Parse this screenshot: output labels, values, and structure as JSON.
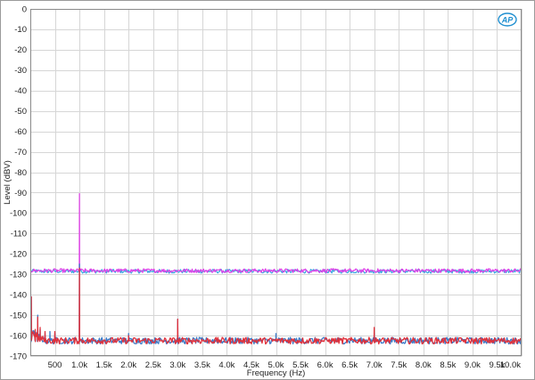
{
  "chart_data": {
    "type": "line",
    "title": "",
    "xlabel": "Frequency (Hz)",
    "ylabel": "Level (dBV)",
    "xlim": [
      0,
      10000
    ],
    "ylim": [
      -170,
      0
    ],
    "grid": true,
    "x_ticks": [
      500,
      1000,
      1500,
      2000,
      2500,
      3000,
      3500,
      4000,
      4500,
      5000,
      5500,
      6000,
      6500,
      7000,
      7500,
      8000,
      8500,
      9000,
      9500,
      10000
    ],
    "x_tick_labels": [
      "500",
      "1.0k",
      "1.5k",
      "2.0k",
      "2.5k",
      "3.0k",
      "3.5k",
      "4.0k",
      "4.5k",
      "5.0k",
      "5.5k",
      "6.0k",
      "6.5k",
      "7.0k",
      "7.5k",
      "8.0k",
      "8.5k",
      "9.0k",
      "9.5k",
      "10.0k"
    ],
    "y_ticks": [
      0,
      -10,
      -20,
      -30,
      -40,
      -50,
      -60,
      -70,
      -80,
      -90,
      -100,
      -110,
      -120,
      -130,
      -140,
      -150,
      -160,
      -170
    ],
    "y_tick_labels": [
      "0",
      "-10",
      "-20",
      "-30",
      "-40",
      "-50",
      "-60",
      "-70",
      "-80",
      "-90",
      "-100",
      "-110",
      "-120",
      "-130",
      "-140",
      "-150",
      "-160",
      "-170"
    ],
    "series": [
      {
        "color": "#3aa7e0",
        "floor": -128.5,
        "noise": 0.6,
        "peaks": [
          [
            1000,
            -129
          ]
        ]
      },
      {
        "color": "#e040e8",
        "floor": -128.2,
        "noise": 0.6,
        "peaks": [
          [
            1000,
            -90.5
          ]
        ]
      },
      {
        "color": "#3a7ac8",
        "floor": -162.5,
        "noise": 1.0,
        "peaks": [
          [
            20,
            -141
          ],
          [
            100,
            -158
          ],
          [
            150,
            -150
          ],
          [
            200,
            -157
          ],
          [
            300,
            -159
          ],
          [
            400,
            -158
          ],
          [
            500,
            -159
          ],
          [
            1000,
            -125
          ],
          [
            2000,
            -159
          ],
          [
            3000,
            -152
          ],
          [
            5000,
            -159
          ],
          [
            7000,
            -159
          ]
        ]
      },
      {
        "color": "#e0303a",
        "floor": -162.5,
        "noise": 1.0,
        "peaks": [
          [
            20,
            -141
          ],
          [
            100,
            -157
          ],
          [
            150,
            -151
          ],
          [
            200,
            -156
          ],
          [
            300,
            -158
          ],
          [
            500,
            -158
          ],
          [
            1000,
            -127
          ],
          [
            2000,
            -160
          ],
          [
            3000,
            -152
          ],
          [
            7000,
            -156
          ]
        ]
      }
    ]
  },
  "logo": {
    "text": "AP",
    "color": "#1f8fd0"
  }
}
